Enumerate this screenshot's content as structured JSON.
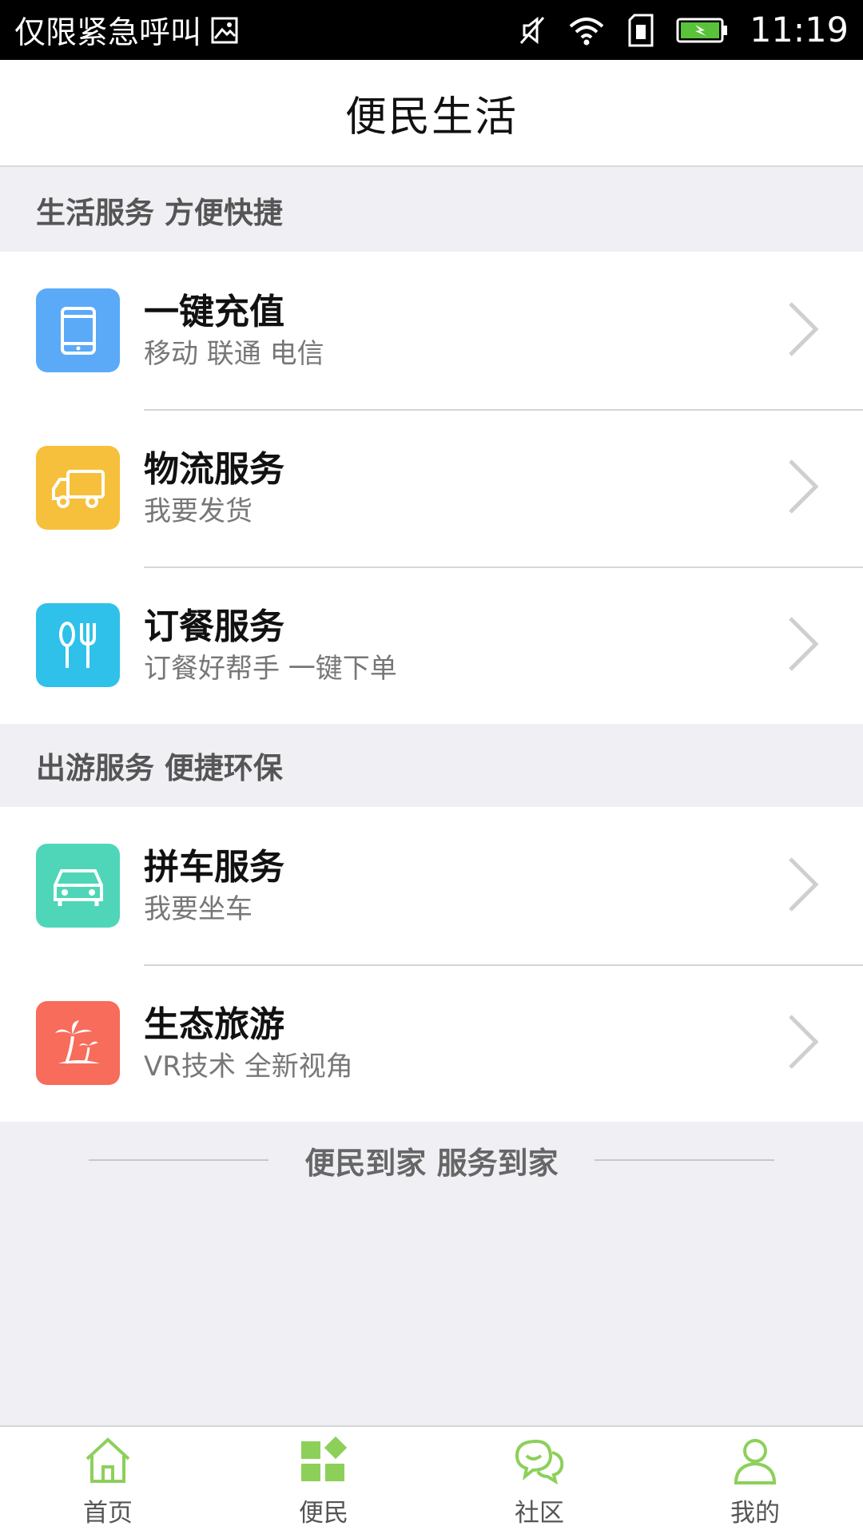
{
  "status_bar": {
    "carrier_text": "仅限紧急呼叫",
    "time": "11:19",
    "icons": [
      "image-icon",
      "mute-icon",
      "wifi-icon",
      "sim-icon",
      "battery-icon"
    ]
  },
  "header": {
    "title": "便民生活"
  },
  "sections": [
    {
      "title": "生活服务 方便快捷",
      "items": [
        {
          "title": "一键充值",
          "subtitle": "移动 联通 电信",
          "icon": "phone-icon",
          "color": "#5aaaf8"
        },
        {
          "title": "物流服务",
          "subtitle": "我要发货",
          "icon": "truck-icon",
          "color": "#f7c03c"
        },
        {
          "title": "订餐服务",
          "subtitle": "订餐好帮手 一键下单",
          "icon": "utensils-icon",
          "color": "#2fc1ea"
        }
      ]
    },
    {
      "title": "出游服务 便捷环保",
      "items": [
        {
          "title": "拼车服务",
          "subtitle": "我要坐车",
          "icon": "car-icon",
          "color": "#4fd6b8"
        },
        {
          "title": "生态旅游",
          "subtitle": "VR技术 全新视角",
          "icon": "palm-tree-icon",
          "color": "#f76c5b"
        }
      ]
    }
  ],
  "footer_note": "便民到家 服务到家",
  "tab_bar": {
    "active_color": "#8cd05a",
    "tabs": [
      {
        "label": "首页",
        "icon": "home-icon"
      },
      {
        "label": "便民",
        "icon": "apps-icon",
        "active": true
      },
      {
        "label": "社区",
        "icon": "chat-icon"
      },
      {
        "label": "我的",
        "icon": "user-icon"
      }
    ]
  }
}
